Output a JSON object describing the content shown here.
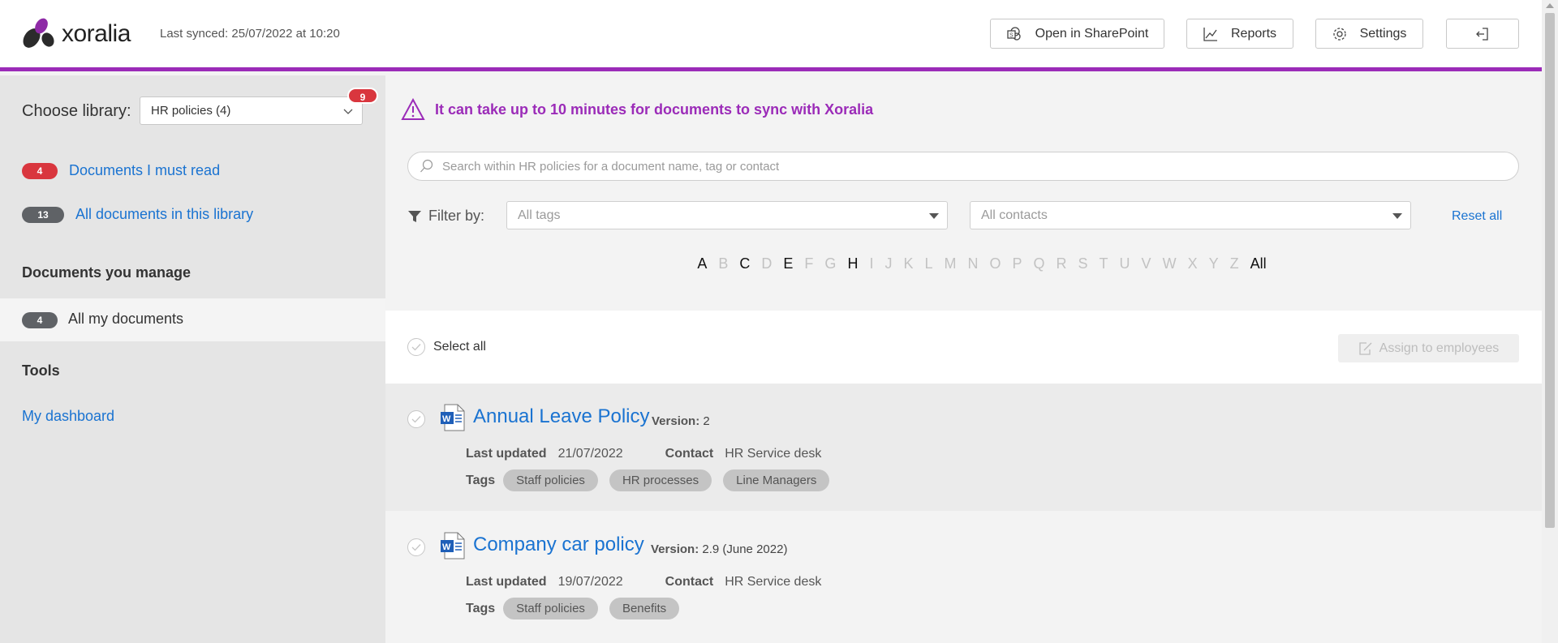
{
  "header": {
    "logo_text": "xoralia",
    "last_synced": "Last synced: 25/07/2022 at 10:20",
    "buttons": {
      "sharepoint": "Open in SharePoint",
      "reports": "Reports",
      "settings": "Settings"
    },
    "accent_color": "#9b2bb8"
  },
  "sidebar": {
    "choose_library_label": "Choose library:",
    "library_selected": "HR policies (4)",
    "library_badge": "9",
    "must_read": {
      "count": "4",
      "label": "Documents I must read"
    },
    "all_docs": {
      "count": "13",
      "label": "All documents in this library"
    },
    "manage_heading": "Documents you manage",
    "my_docs": {
      "count": "4",
      "label": "All my documents"
    },
    "tools_heading": "Tools",
    "dashboard_link": "My dashboard"
  },
  "main": {
    "alert": "It can take up to 10 minutes for documents to sync with Xoralia",
    "search_placeholder": "Search within HR policies for a document name, tag or contact",
    "filter_label": "Filter by:",
    "tags_dropdown": "All tags",
    "contacts_dropdown": "All contacts",
    "reset_all": "Reset all",
    "alphabet": [
      {
        "l": "A",
        "on": true
      },
      {
        "l": "B",
        "on": false
      },
      {
        "l": "C",
        "on": true
      },
      {
        "l": "D",
        "on": false
      },
      {
        "l": "E",
        "on": true
      },
      {
        "l": "F",
        "on": false
      },
      {
        "l": "G",
        "on": false
      },
      {
        "l": "H",
        "on": true
      },
      {
        "l": "I",
        "on": false
      },
      {
        "l": "J",
        "on": false
      },
      {
        "l": "K",
        "on": false
      },
      {
        "l": "L",
        "on": false
      },
      {
        "l": "M",
        "on": false
      },
      {
        "l": "N",
        "on": false
      },
      {
        "l": "O",
        "on": false
      },
      {
        "l": "P",
        "on": false
      },
      {
        "l": "Q",
        "on": false
      },
      {
        "l": "R",
        "on": false
      },
      {
        "l": "S",
        "on": false
      },
      {
        "l": "T",
        "on": false
      },
      {
        "l": "U",
        "on": false
      },
      {
        "l": "V",
        "on": false
      },
      {
        "l": "W",
        "on": false
      },
      {
        "l": "X",
        "on": false
      },
      {
        "l": "Y",
        "on": false
      },
      {
        "l": "Z",
        "on": false
      },
      {
        "l": "All",
        "on": true
      }
    ],
    "select_all": "Select all",
    "assign_button": "Assign to employees"
  },
  "documents": [
    {
      "title": "Annual Leave Policy",
      "version_label": "Version:",
      "version": "2",
      "last_updated_label": "Last updated",
      "last_updated": "21/07/2022",
      "contact_label": "Contact",
      "contact": "HR Service desk",
      "tags_label": "Tags",
      "tags": [
        "Staff policies",
        "HR processes",
        "Line Managers"
      ]
    },
    {
      "title": "Company car policy",
      "version_label": "Version:",
      "version": "2.9 (June 2022)",
      "last_updated_label": "Last updated",
      "last_updated": "19/07/2022",
      "contact_label": "Contact",
      "contact": "HR Service desk",
      "tags_label": "Tags",
      "tags": [
        "Staff policies",
        "Benefits"
      ]
    }
  ]
}
